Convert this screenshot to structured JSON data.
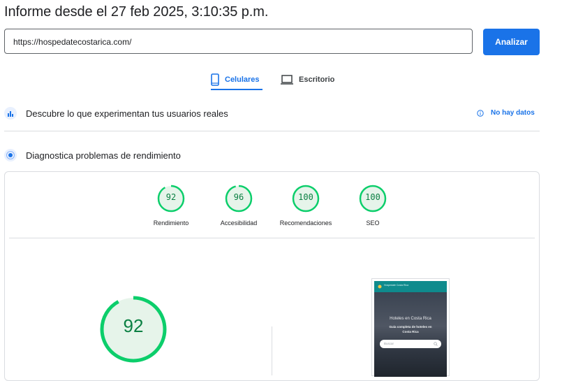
{
  "report": {
    "title": "Informe desde el 27 feb 2025, 3:10:35 p.m."
  },
  "url_input": {
    "value": "https://hospedatecostarica.com/"
  },
  "analyze_button": {
    "label": "Analizar"
  },
  "tabs": [
    {
      "label": "Celulares",
      "icon": "smartphone-icon",
      "active": true
    },
    {
      "label": "Escritorio",
      "icon": "laptop-icon",
      "active": false
    }
  ],
  "real_users": {
    "label": "Descubre lo que experimentan tus usuarios reales",
    "status": "No hay datos",
    "icon": "crux-users-icon"
  },
  "diagnose": {
    "label": "Diagnostica problemas de rendimiento",
    "icon": "lighthouse-icon"
  },
  "scores": [
    {
      "label": "Rendimiento",
      "value": "92"
    },
    {
      "label": "Accesibilidad",
      "value": "96"
    },
    {
      "label": "Recomendaciones",
      "value": "100"
    },
    {
      "label": "SEO",
      "value": "100"
    }
  ],
  "main_score": {
    "value": "92"
  },
  "preview": {
    "header_text": "Hospedate Costa Rica",
    "hero_title": "Hoteles en Costa Rica",
    "hero_subtitle": "Guía completa de hoteles en Costa Rica",
    "search_placeholder": "Buscar"
  },
  "colors": {
    "accent": "#1a73e8",
    "pass": "#0cce6b",
    "pass_text": "#0b8043"
  }
}
